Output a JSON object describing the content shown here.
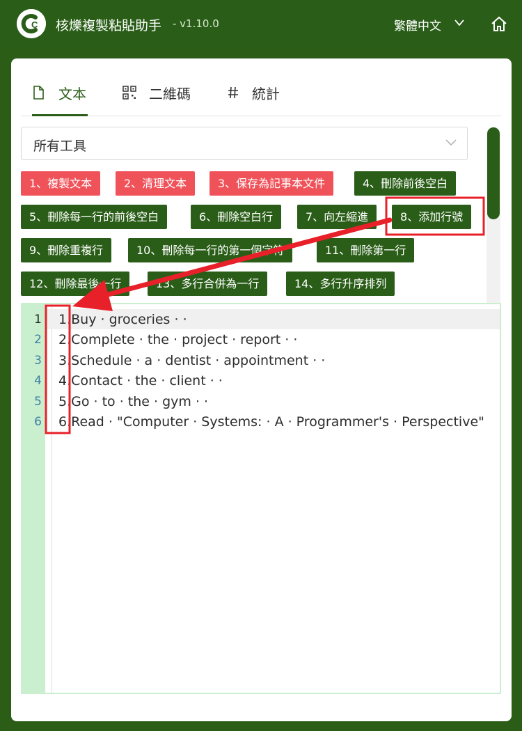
{
  "app": {
    "title": "核爍複製粘貼助手",
    "version": "- v1.10.0",
    "language": "繁體中文"
  },
  "tabs": [
    {
      "label": "文本",
      "icon": "file-icon",
      "active": true
    },
    {
      "label": "二維碼",
      "icon": "qr-code-icon",
      "active": false
    },
    {
      "label": "統計",
      "icon": "hash-icon",
      "active": false
    }
  ],
  "tool_select": {
    "value": "所有工具"
  },
  "tools": [
    {
      "label": "1、複製文本",
      "color": "red"
    },
    {
      "label": "2、清理文本",
      "color": "red"
    },
    {
      "label": "3、保存為記事本文件",
      "color": "red"
    },
    {
      "label": "4、刪除前後空白",
      "color": "green"
    },
    {
      "label": "5、刪除每一行的前後空白",
      "color": "green"
    },
    {
      "label": "6、刪除空白行",
      "color": "green"
    },
    {
      "label": "7、向左縮進",
      "color": "green"
    },
    {
      "label": "8、添加行號",
      "color": "green"
    },
    {
      "label": "9、刪除重複行",
      "color": "green"
    },
    {
      "label": "10、刪除每一行的第一個字符",
      "color": "green"
    },
    {
      "label": "11、刪除第一行",
      "color": "green"
    },
    {
      "label": "12、刪除最後一行",
      "color": "green"
    },
    {
      "label": "13、多行合併為一行",
      "color": "green"
    },
    {
      "label": "14、多行升序排列",
      "color": "green"
    }
  ],
  "editor": {
    "line_numbers": [
      "1",
      "2",
      "3",
      "4",
      "5",
      "6"
    ],
    "lines": [
      "1.Buy · groceries · ·",
      "2.Complete · the · project · report · ·",
      "3.Schedule · a · dentist · appointment · ·",
      "4.Contact · the · client · ·",
      "5.Go · to · the · gym · ·",
      "6.Read · \"Computer · Systems: · A · Programmer's · Perspective\""
    ]
  },
  "colors": {
    "header_bg": "#2a5e18",
    "tool_red": "#f0525a",
    "tool_green": "#2a5e18",
    "gutter_bg": "#c9efcf",
    "annotation_red": "#e8202a"
  }
}
